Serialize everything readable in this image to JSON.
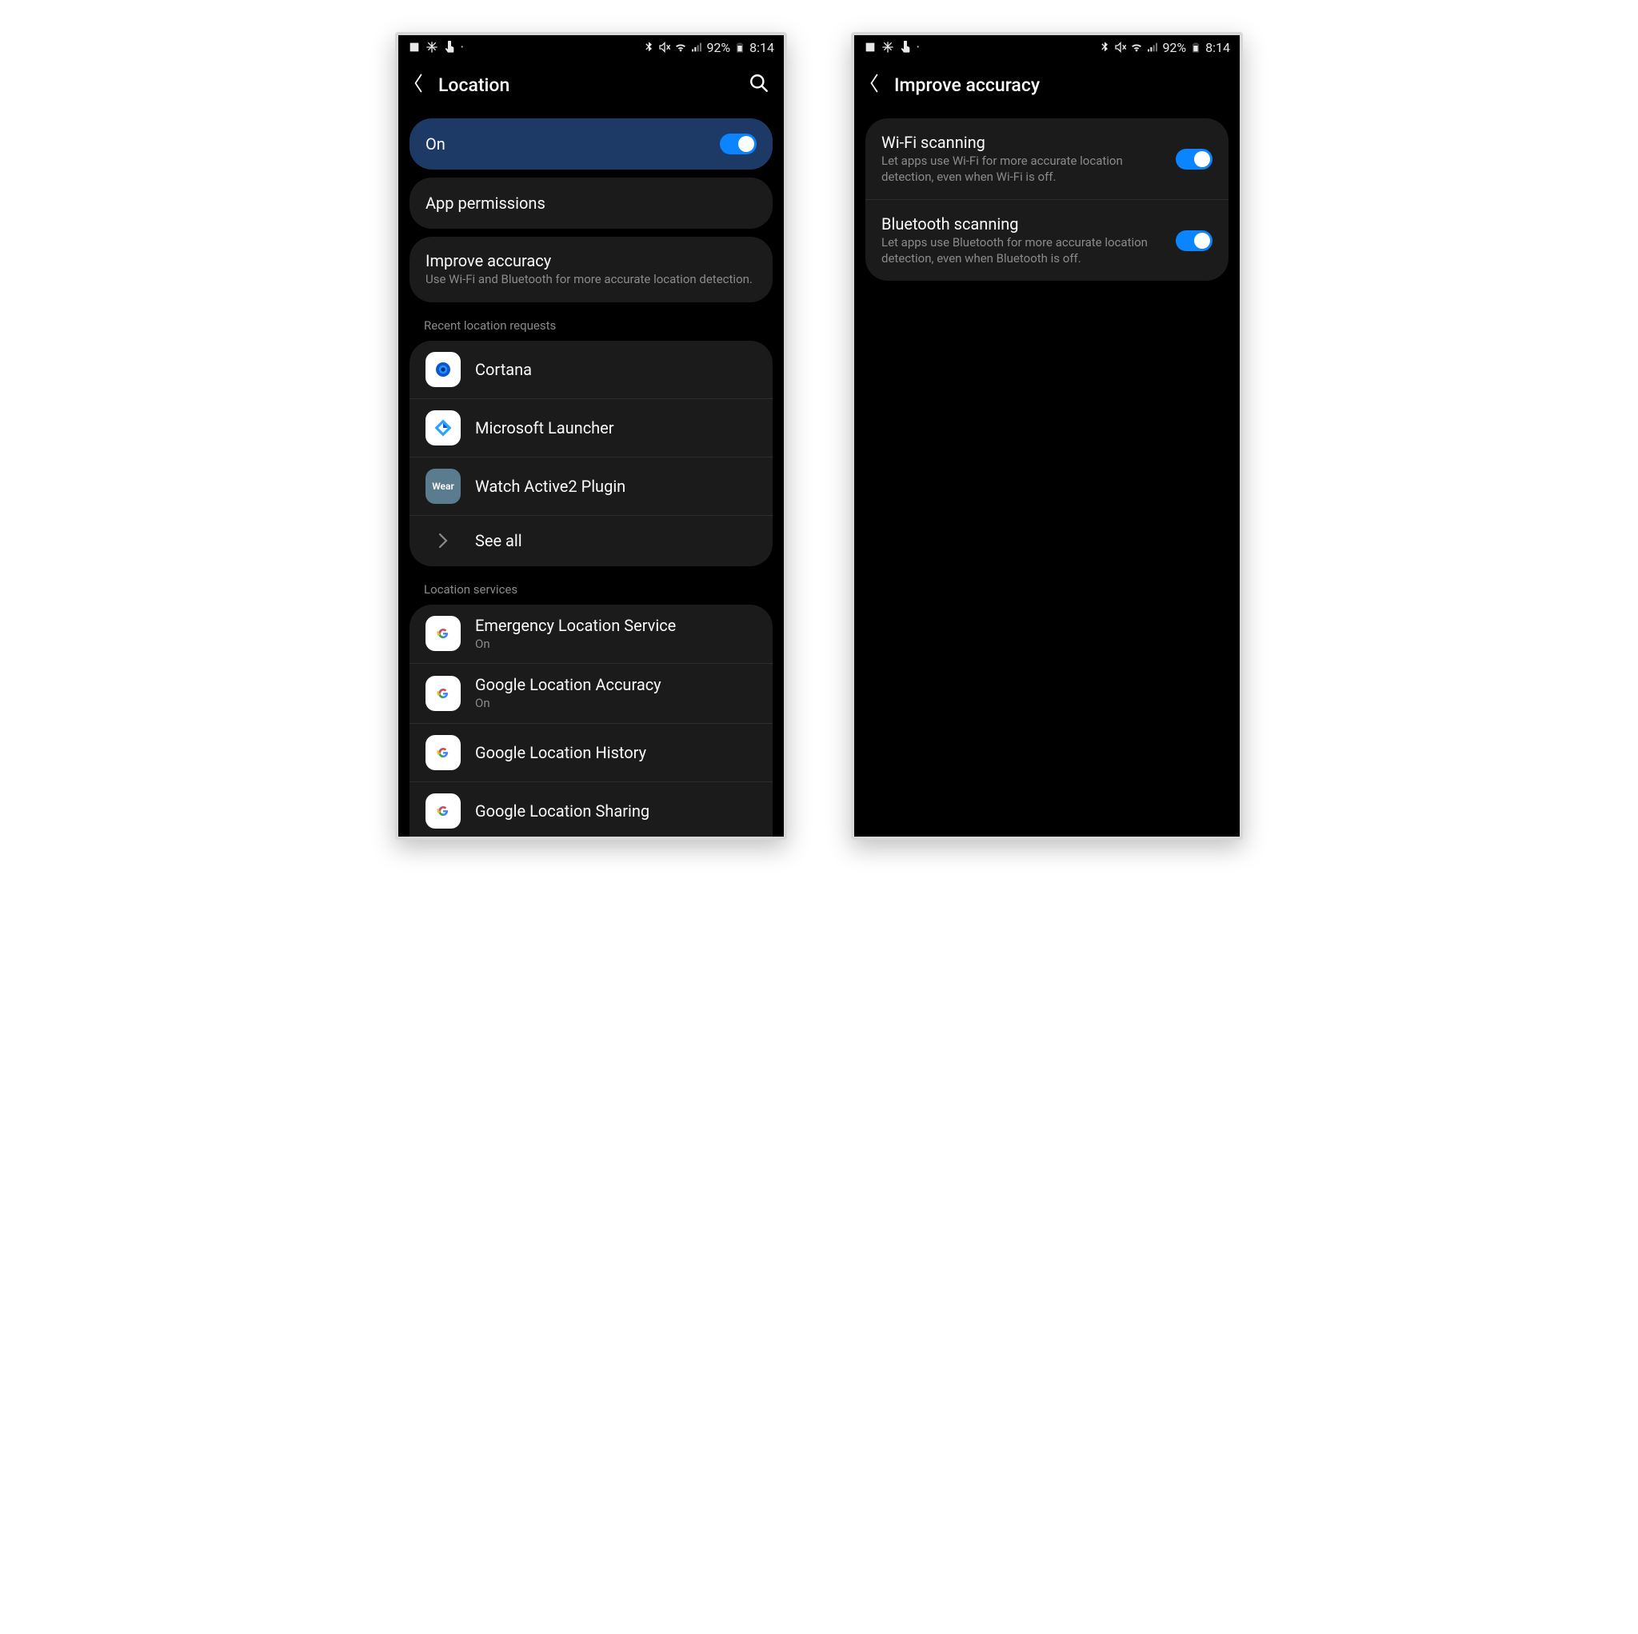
{
  "status": {
    "battery_pct": "92%",
    "time": "8:14"
  },
  "left": {
    "title": "Location",
    "master": {
      "label": "On"
    },
    "app_perm": {
      "label": "App permissions"
    },
    "improve": {
      "label": "Improve accuracy",
      "sub": "Use Wi-Fi and Bluetooth for more accurate location detection."
    },
    "recent_hdr": "Recent location requests",
    "recent": [
      {
        "label": "Cortana"
      },
      {
        "label": "Microsoft Launcher"
      },
      {
        "label": "Watch Active2 Plugin"
      }
    ],
    "see_all": "See all",
    "services_hdr": "Location services",
    "services": [
      {
        "label": "Emergency Location Service",
        "sub": "On"
      },
      {
        "label": "Google Location Accuracy",
        "sub": "On"
      },
      {
        "label": "Google Location History",
        "sub": ""
      },
      {
        "label": "Google Location Sharing",
        "sub": ""
      }
    ]
  },
  "right": {
    "title": "Improve accuracy",
    "items": [
      {
        "label": "Wi-Fi scanning",
        "sub": "Let apps use Wi-Fi for more accurate location detection, even when Wi-Fi is off."
      },
      {
        "label": "Bluetooth scanning",
        "sub": "Let apps use Bluetooth for more accurate location detection, even when Bluetooth is off."
      }
    ]
  }
}
